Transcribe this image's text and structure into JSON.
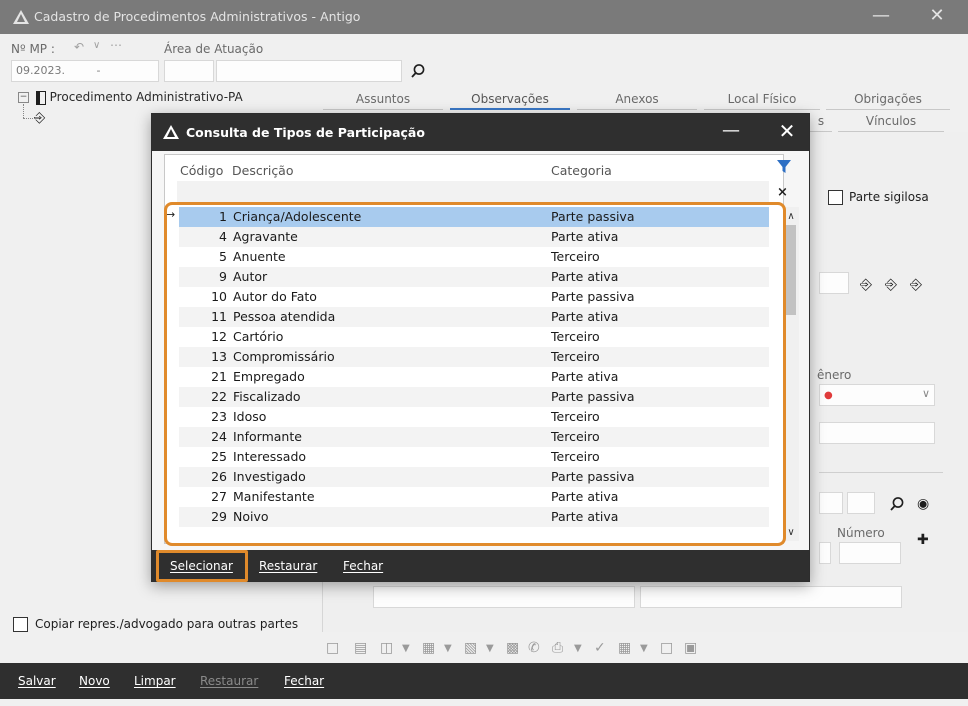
{
  "main_window": {
    "title": "Cadastro de Procedimentos Administrativos - Antigo",
    "mp_label": "Nº MP :",
    "mp_value": "09.2023.",
    "mp_dash": "-",
    "area_label": "Área de Atuação",
    "tree_root": "Procedimento Administrativo-PA",
    "tabs_row1": [
      "Assuntos",
      "Observações",
      "Anexos",
      "Local Físico",
      "Obrigações"
    ],
    "tabs_row2": [
      "s",
      "Vínculos"
    ],
    "parte_sigilosa": "Parte sigilosa",
    "genero_label": "ênero",
    "numero_label": "Número",
    "copiar_label": "Copiar repres./advogado para outras partes",
    "commands": [
      "Salvar",
      "Novo",
      "Limpar",
      "Restaurar",
      "Fechar"
    ]
  },
  "dialog": {
    "title": "Consulta de Tipos de Participação",
    "columns": [
      "Código",
      "Descrição",
      "Categoria"
    ],
    "rows": [
      {
        "code": "1",
        "desc": "Criança/Adolescente",
        "cat": "Parte passiva"
      },
      {
        "code": "4",
        "desc": "Agravante",
        "cat": "Parte ativa"
      },
      {
        "code": "5",
        "desc": "Anuente",
        "cat": "Terceiro"
      },
      {
        "code": "9",
        "desc": "Autor",
        "cat": "Parte ativa"
      },
      {
        "code": "10",
        "desc": "Autor do Fato",
        "cat": "Parte passiva"
      },
      {
        "code": "11",
        "desc": "Pessoa atendida",
        "cat": "Parte ativa"
      },
      {
        "code": "12",
        "desc": "Cartório",
        "cat": "Terceiro"
      },
      {
        "code": "13",
        "desc": "Compromissário",
        "cat": "Terceiro"
      },
      {
        "code": "21",
        "desc": "Empregado",
        "cat": "Parte ativa"
      },
      {
        "code": "22",
        "desc": "Fiscalizado",
        "cat": "Parte passiva"
      },
      {
        "code": "23",
        "desc": "Idoso",
        "cat": "Terceiro"
      },
      {
        "code": "24",
        "desc": "Informante",
        "cat": "Terceiro"
      },
      {
        "code": "25",
        "desc": "Interessado",
        "cat": "Terceiro"
      },
      {
        "code": "26",
        "desc": "Investigado",
        "cat": "Parte passiva"
      },
      {
        "code": "27",
        "desc": "Manifestante",
        "cat": "Parte ativa"
      },
      {
        "code": "29",
        "desc": "Noivo",
        "cat": "Parte ativa"
      }
    ],
    "commands": [
      "Selecionar",
      "Restaurar",
      "Fechar"
    ]
  },
  "colors": {
    "highlight": "#e08a2b",
    "selected_row": "#a8cbee",
    "dark_bar": "#2f2f2f"
  }
}
